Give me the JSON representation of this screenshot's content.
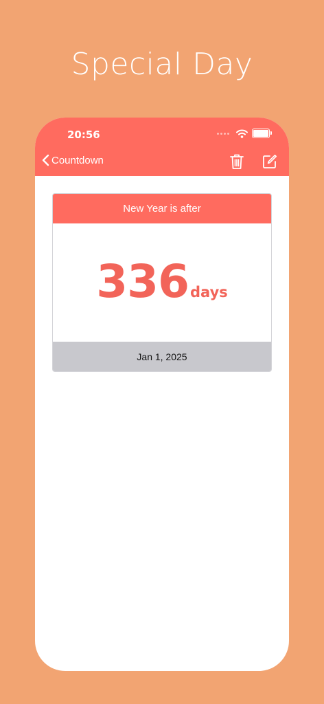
{
  "banner": {
    "title": "Special Day"
  },
  "status_bar": {
    "time": "20:56",
    "icons": [
      "signal-dots-icon",
      "wifi-icon",
      "battery-icon"
    ]
  },
  "nav_bar": {
    "back_label": "Countdown",
    "actions": [
      "trash-icon",
      "edit-icon"
    ]
  },
  "countdown_card": {
    "header": "New Year is after",
    "count": "336",
    "unit": "days",
    "date": "Jan 1, 2025"
  },
  "colors": {
    "background": "#F2A472",
    "accent": "#FF6B5F",
    "count_text": "#F26459",
    "footer": "#C8C8CD"
  }
}
